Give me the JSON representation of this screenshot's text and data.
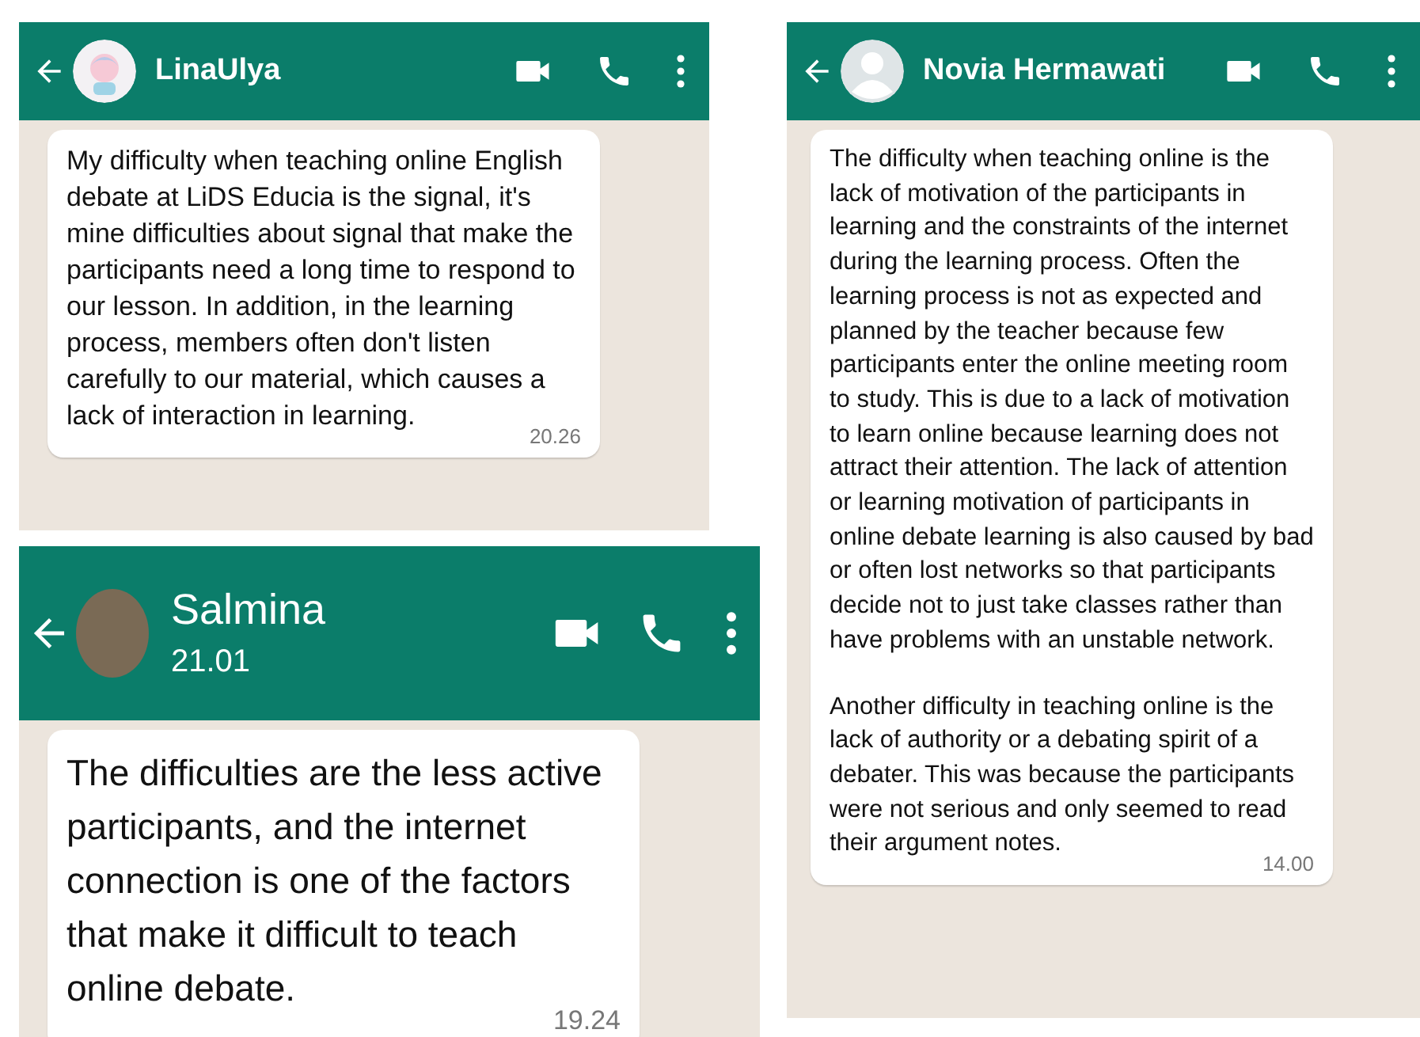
{
  "chats": [
    {
      "contact": {
        "name": "LinaUlya",
        "avatar": {
          "kind": "drawing"
        }
      },
      "kind": "small",
      "messages": [
        {
          "paragraphs": [
            "My difficulty when teaching online English debate at LiDS Educia is the signal, it's mine difficulties about signal that make the participants need a long time to respond to our lesson. In addition, in the learning process, members often don't listen carefully to our material, which causes a lack of interaction in learning."
          ],
          "time": "20.26"
        }
      ]
    },
    {
      "contact": {
        "name": "Salmina",
        "avatar": {
          "kind": "photo"
        },
        "status": "21.01"
      },
      "kind": "large",
      "messages": [
        {
          "paragraphs": [
            "The difficulties are the less active participants, and the internet connection is one of the factors that make it difficult to teach online debate."
          ],
          "time": "19.24"
        }
      ]
    },
    {
      "contact": {
        "name": "Novia Hermawati",
        "avatar": {
          "kind": "default"
        }
      },
      "kind": "small",
      "messages": [
        {
          "paragraphs": [
            "The difficulty when teaching online is the lack of motivation of the participants in learning and the constraints of the internet during the learning process.  Often the learning process is not as expected and planned by the teacher because few participants enter the online meeting room to study.  This is due to a lack of motivation to learn online because learning does not attract their attention.  The lack of attention or learning motivation of participants in online debate learning is also caused by bad or often lost networks so that participants decide not to just take classes rather than have problems with an unstable network.",
            "Another difficulty in teaching online is the lack of authority or a debating spirit of a debater.  This was because the participants were not serious and only seemed to read their argument notes."
          ],
          "time": "14.00"
        }
      ]
    }
  ]
}
